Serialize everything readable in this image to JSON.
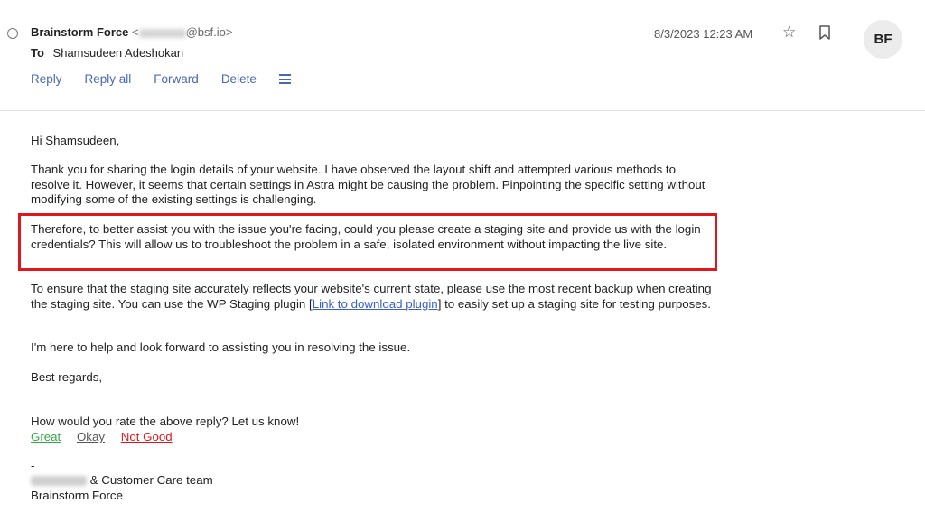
{
  "header": {
    "sender_name": "Brainstorm Force",
    "sender_email_prefix": "<",
    "sender_email_suffix": "@bsf.io>",
    "to_label": "To",
    "recipient": "Shamsudeen Adeshokan",
    "date": "8/3/2023 12:23 AM",
    "avatar_initials": "BF",
    "actions": [
      "Reply",
      "Reply all",
      "Forward",
      "Delete"
    ]
  },
  "icons": {
    "star": "star-icon",
    "bookmark": "bookmark-icon",
    "menu": "hamburger-menu-icon"
  },
  "body": {
    "greeting": "Hi Shamsudeen,",
    "p1": "Thank you for sharing the login details of your website. I have observed the layout shift and attempted various methods to resolve it. However, it seems that certain settings in Astra might be causing the problem. Pinpointing the specific setting without modifying some of the existing settings is challenging.",
    "p2": "Therefore, to better assist you with the issue you're facing, could you please create a staging site and provide us with the login credentials? This will allow us to troubleshoot the problem in a safe, isolated environment without impacting the live site.",
    "p3_before": "To ensure that the staging site accurately reflects your website's current state, please use the most recent backup when creating the staging site. You can use the WP Staging plugin [",
    "p3_link": "Link to download plugin",
    "p3_after": "] to easily set up a staging site for testing purposes.",
    "p4": "I'm here to help and look forward to assisting you in resolving the issue.",
    "p5": "Best regards,",
    "rating_prompt": "How would you rate the above reply? Let us know!",
    "rating_options": [
      "Great",
      "Okay",
      "Not Good"
    ],
    "dash": "-",
    "signature_team": " & Customer Care team",
    "signature_company": "Brainstorm Force"
  },
  "colors": {
    "link_blue": "#4a66b5",
    "highlight_red": "#e0151e",
    "great_green": "#37a84a"
  }
}
